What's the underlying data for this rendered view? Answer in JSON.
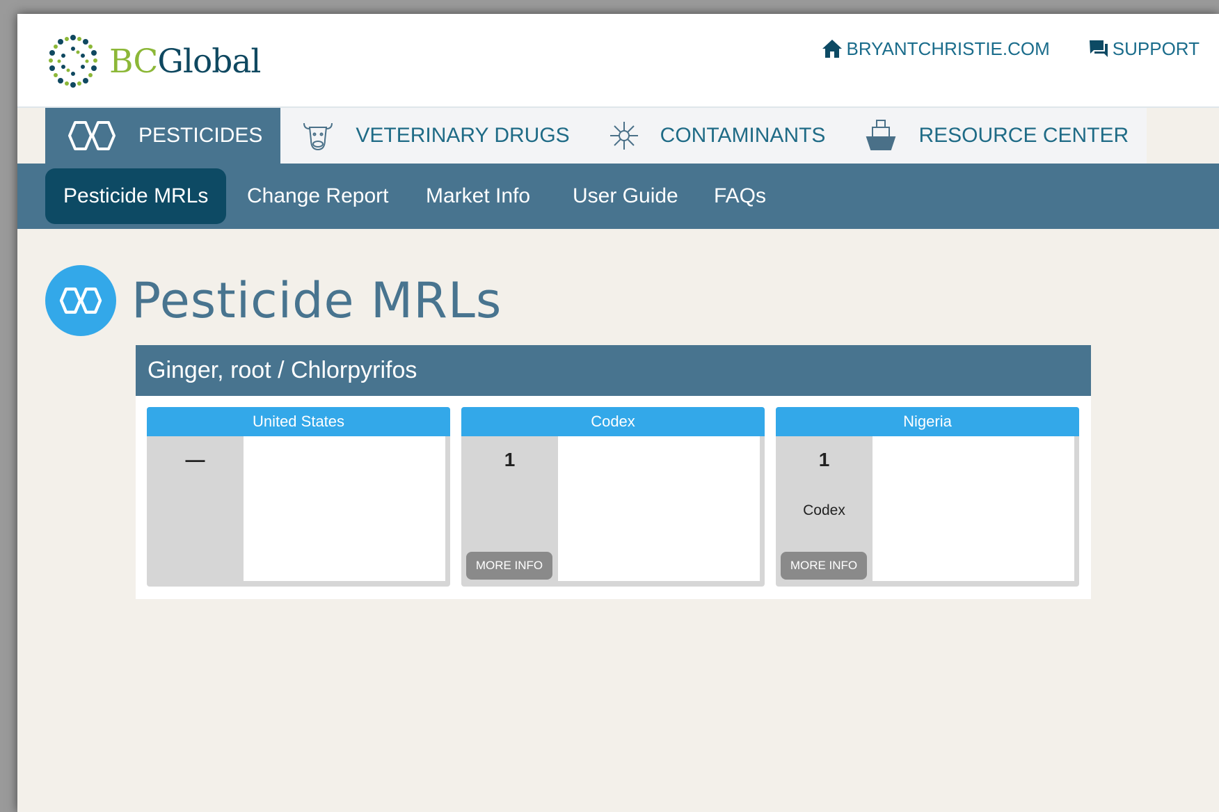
{
  "header": {
    "logo": {
      "bc": "BC",
      "global": "Global"
    },
    "links": [
      {
        "label": "BRYANTCHRISTIE.COM",
        "icon": "home-icon"
      },
      {
        "label": "SUPPORT",
        "icon": "chat-icon"
      }
    ]
  },
  "main_nav": [
    {
      "label": "PESTICIDES",
      "icon": "hexagon-molecule-icon",
      "active": true
    },
    {
      "label": "VETERINARY DRUGS",
      "icon": "cow-icon",
      "active": false
    },
    {
      "label": "CONTAMINANTS",
      "icon": "virus-icon",
      "active": false
    },
    {
      "label": "RESOURCE CENTER",
      "icon": "ship-icon",
      "active": false
    }
  ],
  "sub_nav": [
    {
      "label": "Pesticide MRLs",
      "active": true
    },
    {
      "label": "Change Report",
      "active": false
    },
    {
      "label": "Market Info",
      "active": false
    },
    {
      "label": "User Guide",
      "active": false
    },
    {
      "label": "FAQs",
      "active": false
    }
  ],
  "page": {
    "title": "Pesticide MRLs"
  },
  "result": {
    "title": "Ginger, root / Chlorpyrifos",
    "markets": [
      {
        "name": "United States",
        "value": "—",
        "source": "",
        "more_info": ""
      },
      {
        "name": "Codex",
        "value": "1",
        "source": "",
        "more_info": "MORE INFO"
      },
      {
        "name": "Nigeria",
        "value": "1",
        "source": "Codex",
        "more_info": "MORE INFO"
      }
    ]
  },
  "colors": {
    "nav_blue": "#48748f",
    "active_dark": "#0d4a64",
    "accent_blue": "#33a8e9",
    "page_bg": "#f3f0ea",
    "logo_green": "#8cb737"
  }
}
